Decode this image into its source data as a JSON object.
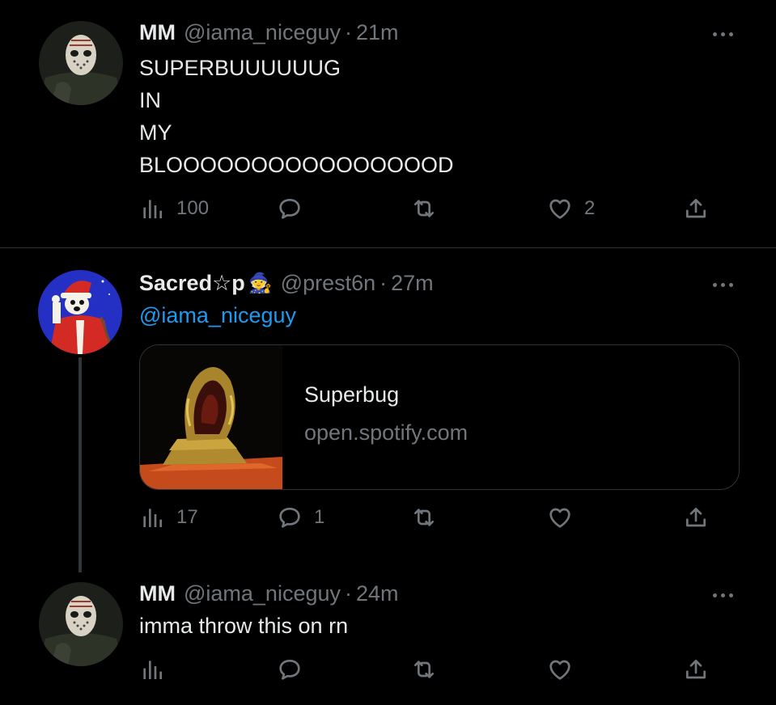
{
  "tweets": [
    {
      "name": "MM",
      "handle": "@iama_niceguy",
      "dot": "·",
      "time": "21m",
      "lines": [
        "SUPERBUUUUUUG",
        "IN",
        "MY",
        "BLOOOOOOOOOOOOOOOOD"
      ],
      "views": "100",
      "replies": "",
      "retweets": "",
      "likes": "2"
    },
    {
      "name": "Sacred☆p",
      "name_emoji": "🧙",
      "handle": "@prest6n",
      "dot": "·",
      "time": "27m",
      "mention": "@iama_niceguy",
      "card": {
        "title": "Superbug",
        "domain": "open.spotify.com"
      },
      "views": "17",
      "replies": "1",
      "retweets": "",
      "likes": ""
    },
    {
      "name": "MM",
      "handle": "@iama_niceguy",
      "dot": "·",
      "time": "24m",
      "text": "imma throw this on rn",
      "views": "",
      "replies": "",
      "retweets": "",
      "likes": ""
    }
  ],
  "colors": {
    "background": "#000000",
    "text": "#e7e9ea",
    "secondary": "#71767b",
    "link": "#1d9bf0",
    "border": "#2f3336"
  },
  "icons": [
    "views-icon",
    "reply-icon",
    "retweet-icon",
    "like-icon",
    "share-icon",
    "more-icon"
  ]
}
